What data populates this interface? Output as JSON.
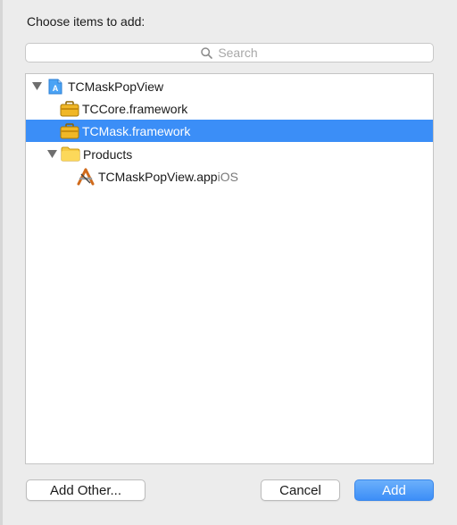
{
  "dialog": {
    "title": "Choose items to add:",
    "search": {
      "placeholder": "Search"
    }
  },
  "tree": [
    {
      "label": "TCMaskPopView",
      "icon": "xcode-project-icon",
      "expanded": true,
      "selected": false
    },
    {
      "label": "TCCore.framework",
      "icon": "framework-icon",
      "selected": false
    },
    {
      "label": "TCMask.framework",
      "icon": "framework-icon",
      "selected": true
    },
    {
      "label": "Products",
      "icon": "folder-icon",
      "expanded": true,
      "selected": false
    },
    {
      "label": "TCMaskPopView.app",
      "platform": "iOS",
      "icon": "app-icon",
      "selected": false
    }
  ],
  "buttons": {
    "add_other": "Add Other...",
    "cancel": "Cancel",
    "add": "Add"
  },
  "colors": {
    "selection": "#3b8ef7",
    "primary_button": "#3d8ef7"
  }
}
